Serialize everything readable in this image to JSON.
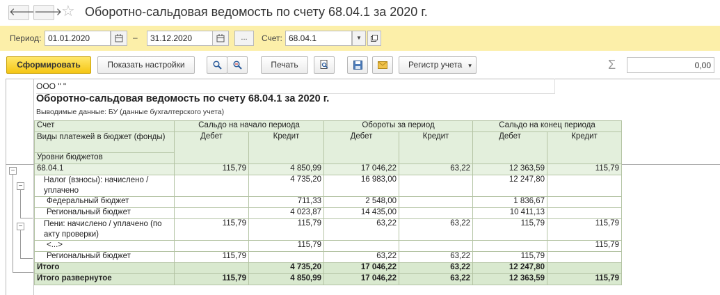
{
  "window": {
    "title": "Оборотно-сальдовая ведомость по счету 68.04.1 за 2020 г."
  },
  "nav": {
    "back": "🡐",
    "forward": "🡒",
    "star": "☆"
  },
  "period": {
    "label": "Период:",
    "from": "01.01.2020",
    "dash": "–",
    "to": "31.12.2020",
    "more": "...",
    "account_label": "Счет:",
    "account": "68.04.1"
  },
  "toolbar": {
    "generate": "Сформировать",
    "show_settings": "Показать настройки",
    "print": "Печать",
    "register": "Регистр учета",
    "sum_value": "0,00",
    "sigma": "Σ"
  },
  "report": {
    "org": "ООО \"           \"",
    "title": "Оборотно-сальдовая ведомость по счету 68.04.1 за 2020 г.",
    "subtitle": "Выводимые данные:  БУ (данные бухгалтерского учета)",
    "headers": {
      "account": "Счет",
      "payment_types": "Виды платежей в бюджет (фонды)",
      "budget_levels": "Уровни бюджетов",
      "opening": "Сальдо на начало периода",
      "turnover": "Обороты за период",
      "closing": "Сальдо на конец периода",
      "debit": "Дебет",
      "credit": "Кредит"
    },
    "rows": [
      {
        "name": "68.04.1",
        "v": [
          "115,79",
          "4 850,99",
          "17 046,22",
          "63,22",
          "12 363,59",
          "115,79"
        ]
      },
      {
        "name": "Налог (взносы): начислено / уплачено",
        "v": [
          "",
          "4 735,20",
          "16 983,00",
          "",
          "12 247,80",
          ""
        ]
      },
      {
        "name": "Федеральный бюджет",
        "v": [
          "",
          "711,33",
          "2 548,00",
          "",
          "1 836,67",
          ""
        ]
      },
      {
        "name": "Региональный бюджет",
        "v": [
          "",
          "4 023,87",
          "14 435,00",
          "",
          "10 411,13",
          ""
        ]
      },
      {
        "name": "Пени: начислено / уплачено (по акту проверки)",
        "v": [
          "115,79",
          "115,79",
          "63,22",
          "63,22",
          "115,79",
          "115,79"
        ]
      },
      {
        "name": "<...>",
        "v": [
          "",
          "115,79",
          "",
          "",
          "",
          "115,79"
        ]
      },
      {
        "name": "Региональный бюджет",
        "v": [
          "115,79",
          "",
          "63,22",
          "63,22",
          "115,79",
          ""
        ]
      }
    ],
    "total": {
      "name": "Итого",
      "v": [
        "",
        "4 735,20",
        "17 046,22",
        "63,22",
        "12 247,80",
        ""
      ]
    },
    "total_expanded": {
      "name": "Итого развернутое",
      "v": [
        "115,79",
        "4 850,99",
        "17 046,22",
        "63,22",
        "12 363,59",
        "115,79"
      ]
    }
  }
}
